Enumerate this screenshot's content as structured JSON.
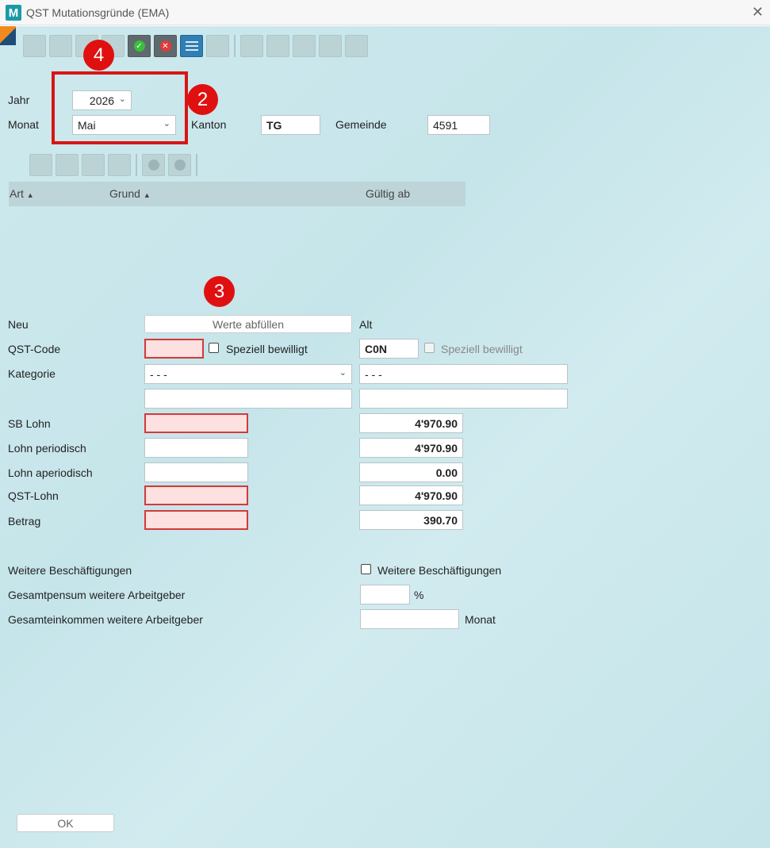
{
  "window": {
    "title": "QST Mutationsgründe (EMA)",
    "logo_letter": "M"
  },
  "top": {
    "jahr_label": "Jahr",
    "jahr_value": "2026",
    "monat_label": "Monat",
    "monat_value": "Mai",
    "kanton_label": "Kanton",
    "kanton_value": "TG",
    "gemeinde_label": "Gemeinde",
    "gemeinde_value": "4591"
  },
  "grid": {
    "columns": [
      "Art",
      "Grund",
      "Gültig ab"
    ]
  },
  "form": {
    "neu_label": "Neu",
    "alt_label": "Alt",
    "fill_button": "Werte abfüllen",
    "qst_code_label": "QST-Code",
    "speziell_label": "Speziell bewilligt",
    "qst_code_alt": "C0N",
    "kategorie_label": "Kategorie",
    "kategorie_neu": "- - -",
    "kategorie_alt": "- - -",
    "sb_lohn_label": "SB Lohn",
    "sb_lohn_alt": "4'970.90",
    "lohn_periodisch_label": "Lohn periodisch",
    "lohn_periodisch_alt": "4'970.90",
    "lohn_aperiodisch_label": "Lohn aperiodisch",
    "lohn_aperiodisch_alt": "0.00",
    "qst_lohn_label": "QST-Lohn",
    "qst_lohn_alt": "4'970.90",
    "betrag_label": "Betrag",
    "betrag_alt": "390.70",
    "weitere_label": "Weitere Beschäftigungen",
    "weitere_checkbox_label": "Weitere Beschäftigungen",
    "pensum_label": "Gesamtpensum weitere Arbeitgeber",
    "pensum_unit": "%",
    "einkommen_label": "Gesamteinkommen weitere Arbeitgeber",
    "einkommen_unit": "Monat"
  },
  "ok_button": "OK",
  "annotations": {
    "badge_4": "4",
    "badge_2": "2",
    "badge_3": "3"
  },
  "colors": {
    "accent": "#1a9aa6",
    "annotation_red": "#e01010",
    "required_bg": "#fde0e0"
  }
}
